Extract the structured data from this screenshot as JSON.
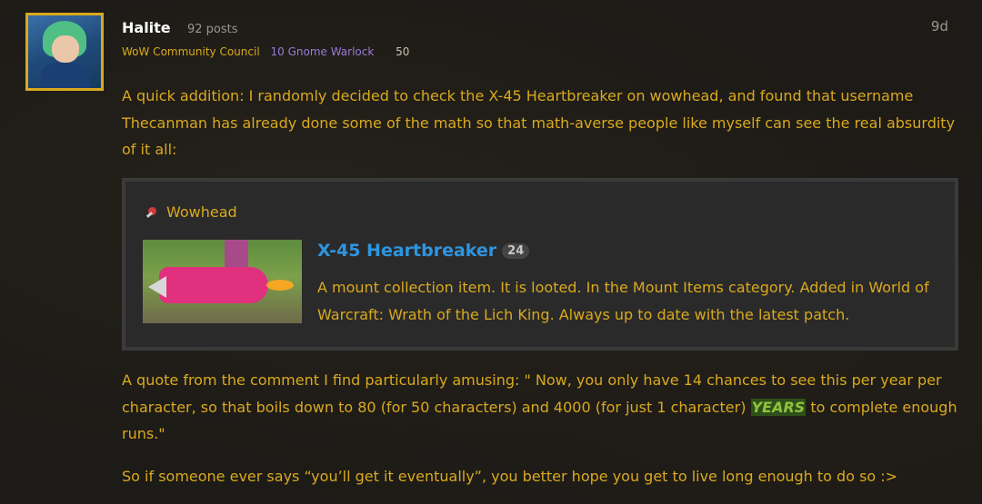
{
  "post": {
    "author": {
      "username": "Halite",
      "post_count": "92 posts",
      "flair_group": "WoW Community Council",
      "character": "10 Gnome Warlock",
      "level": "50"
    },
    "time_ago": "9d",
    "paragraph1": "A quick addition: I randomly decided to check the X-45 Heartbreaker on wowhead, and found that username Thecanman has already done some of the math so that math-averse people like myself can see the real absurdity of it all:",
    "onebox": {
      "source": "Wowhead",
      "source_icon": "wowhead-icon",
      "title": "X-45 Heartbreaker",
      "badge": "24",
      "description": "A mount collection item. It is looted. In the Mount Items category. Added in World of Warcraft: Wrath of the Lich King. Always up to date with the latest patch."
    },
    "paragraph2_before": "A quote from the comment I find particularly amusing: \" Now, you only have 14 chances to see this per year per character, so that boils down to 80 (for 50 characters) and 4000 (for just 1 character) ",
    "paragraph2_highlight": "YEARS",
    "paragraph2_after": " to complete enough runs.\"",
    "paragraph3": "So if someone ever says “you’ll get it eventually”, you better hope you get to live long enough to do so :>"
  },
  "colors": {
    "accent_gold": "#d9a91e",
    "link_blue": "#2e95e0",
    "class_purple": "#9b7ad8",
    "highlight_green": "#8ec33d"
  }
}
